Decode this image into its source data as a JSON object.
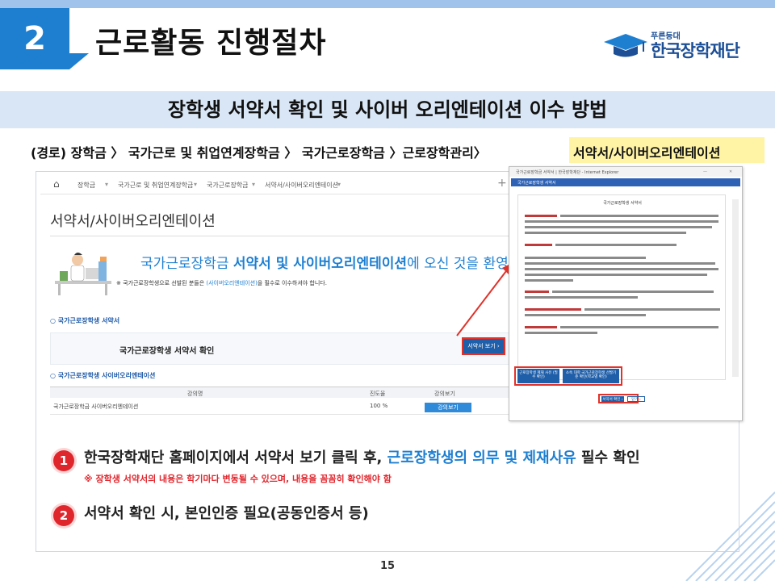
{
  "header": {
    "section_number": "2",
    "title": "근로활동 진행절차",
    "logo_small": "푸른등대",
    "logo_main": "한국장학재단"
  },
  "subtitle": "장학생 서약서 확인 및 사이버 오리엔테이션 이수 방법",
  "route": {
    "text": "(경로) 장학금 〉 국가근로 및  취업연계장학금 〉 국가근로장학금 〉근로장학관리〉",
    "highlight": "서약서/사이버오리엔테이션"
  },
  "site": {
    "nav": [
      "장학금",
      "국가근로 및 취업연계장학금",
      "국가근로장학금",
      "서약서/사이버오리엔테이션"
    ],
    "heading": "서약서/사이버오리엔테이션",
    "welcome_prefix": "국가근로장학금 ",
    "welcome_bold": "서약서 및 사이버오리엔테이션",
    "welcome_suffix": "에 오신 것을 환영합니",
    "note_prefix": "※ 국가근로장학생으로 선발된 분들은 ",
    "note_link": "(사이버오리엔테이션)",
    "note_suffix": "을 필수로 이수하셔야 합니다.",
    "pledge_section": "국가근로장학생 서약서",
    "pledge_confirm": "국가근로장학생 서약서 확인",
    "pledge_view_button": "서약서 보기 ›",
    "ot_section": "국가근로장학생 사이버오리엔테이션",
    "table_headers": [
      "강의명",
      "진도율",
      "강의보기"
    ],
    "table_row": {
      "name": "국가근로장학금 사이버오리엔테이션",
      "progress": "100 %",
      "button": "강의보기"
    }
  },
  "popup": {
    "window_title": "국가근로장학금 서약서 | 한국장학재단 - Internet Explorer",
    "tab_label": "국가근로장학생 서약서",
    "doc_title": "국가근로장학생 서약서",
    "button_1": "근로장학생 제재 사유 (필수 확인)",
    "button_2": "소속 대학 국가근로장학생 선발기준 확인(학교별 확인)",
    "confirm_button": "서약서 확인 ›",
    "close_button": "닫기 ›"
  },
  "steps": [
    {
      "number": "1",
      "text_prefix": "한국장학재단 홈페이지에서 서약서 보기 클릭 후, ",
      "text_accent": "근로장학생의 의무 및 제재사유",
      "text_suffix": " 필수 확인",
      "note": "※ 장학생 서약서의 내용은 학기마다 변동될 수 있으며, 내용을 꼼꼼히 확인해야 함"
    },
    {
      "number": "2",
      "text": "서약서 확인 시, 본인인증 필요(공동인증서 등)"
    }
  ],
  "page_number": "15",
  "colors": {
    "brand_blue": "#1e7fd1",
    "band_light": "#d9e6f5",
    "highlight": "#fff4a6",
    "accent_red": "#e0262d"
  }
}
